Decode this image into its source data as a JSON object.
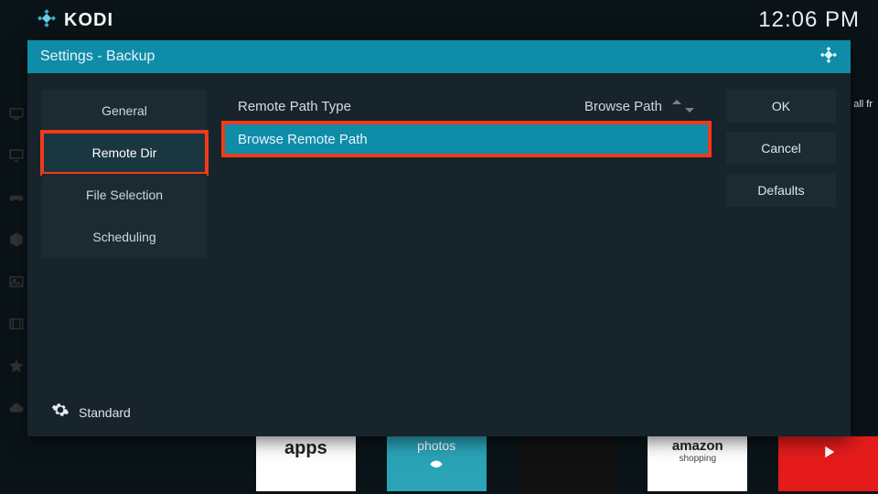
{
  "topbar": {
    "brand": "KODI",
    "clock": "12:06 PM"
  },
  "modal": {
    "title": "Settings - Backup",
    "sidebar": {
      "items": [
        {
          "label": "General"
        },
        {
          "label": "Remote Dir"
        },
        {
          "label": "File Selection"
        },
        {
          "label": "Scheduling"
        }
      ],
      "level_label": "Standard"
    },
    "settings": {
      "rows": [
        {
          "label": "Remote Path Type",
          "value": "Browse Path"
        },
        {
          "label": "Browse Remote Path",
          "value": ""
        }
      ]
    },
    "actions": {
      "ok": "OK",
      "cancel": "Cancel",
      "defaults": "Defaults"
    }
  },
  "background_tiles": {
    "apps": "apps",
    "photos": "photos",
    "amazon": "amazon",
    "amazon_sub": "shopping"
  },
  "edge_text": "all fr"
}
